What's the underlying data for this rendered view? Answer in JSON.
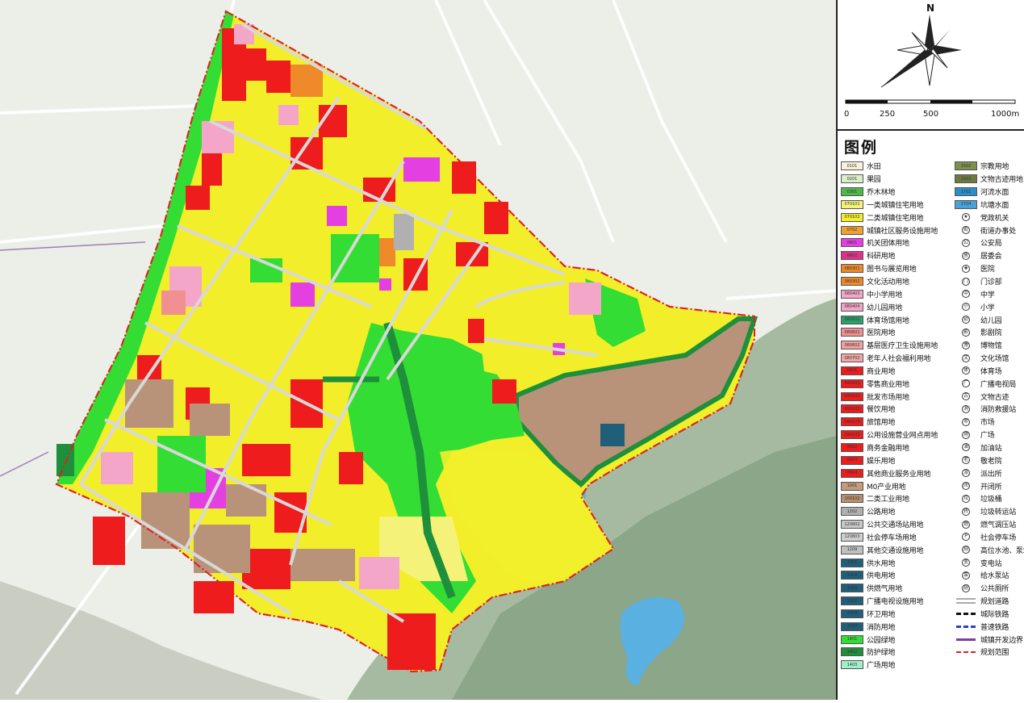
{
  "compass": {
    "north": "N"
  },
  "scale": {
    "ticks": [
      "0",
      "250",
      "500",
      "1000m"
    ]
  },
  "legend": {
    "title": "图例",
    "col1": [
      {
        "code": "0101",
        "label": "水田",
        "color": "#f6f0dc"
      },
      {
        "code": "0201",
        "label": "果园",
        "color": "#d9efc6"
      },
      {
        "code": "0301",
        "label": "乔木林地",
        "color": "#4fb84a"
      },
      {
        "code": "070101",
        "label": "一类城镇住宅用地",
        "color": "#f5f27a"
      },
      {
        "code": "070102",
        "label": "二类城镇住宅用地",
        "color": "#f2ef2a"
      },
      {
        "code": "0702",
        "label": "城镇社区服务设施用地",
        "color": "#f0a030"
      },
      {
        "code": "0801",
        "label": "机关团体用地",
        "color": "#e43fe0"
      },
      {
        "code": "0802",
        "label": "科研用地",
        "color": "#e0308a"
      },
      {
        "code": "080301",
        "label": "图书与展览用地",
        "color": "#ee8a2a"
      },
      {
        "code": "080302",
        "label": "文化活动用地",
        "color": "#ee8a2a"
      },
      {
        "code": "080403",
        "label": "中小学用地",
        "color": "#f4a6c8"
      },
      {
        "code": "080404",
        "label": "幼儿园用地",
        "color": "#f4a6c8"
      },
      {
        "code": "080502",
        "label": "体育场馆用地",
        "color": "#2aa06a"
      },
      {
        "code": "080601",
        "label": "医院用地",
        "color": "#f09090"
      },
      {
        "code": "080602",
        "label": "基层医疗卫生设施用地",
        "color": "#f4a0a0"
      },
      {
        "code": "080702",
        "label": "老年人社会福利用地",
        "color": "#f4a6a6"
      },
      {
        "code": "0901",
        "label": "商业用地",
        "color": "#ee1c1c"
      },
      {
        "code": "090101",
        "label": "零售商业用地",
        "color": "#ee1c1c"
      },
      {
        "code": "090102",
        "label": "批发市场用地",
        "color": "#ee1c1c"
      },
      {
        "code": "090103",
        "label": "餐饮用地",
        "color": "#ee1c1c"
      },
      {
        "code": "090104",
        "label": "旅馆用地",
        "color": "#ee1c1c"
      },
      {
        "code": "090105",
        "label": "公用设施营业网点用地",
        "color": "#ee1c1c"
      },
      {
        "code": "0902",
        "label": "商务金融用地",
        "color": "#ee1c1c"
      },
      {
        "code": "0903",
        "label": "娱乐用地",
        "color": "#ee1c1c"
      },
      {
        "code": "0904",
        "label": "其他商业服务业用地",
        "color": "#ee1c1c"
      },
      {
        "code": "1001",
        "label": "M0产业用地",
        "color": "#c49a7a"
      },
      {
        "code": "100102",
        "label": "二类工业用地",
        "color": "#b98e6e"
      },
      {
        "code": "1202",
        "label": "公路用地",
        "color": "#b0b0b0"
      },
      {
        "code": "120802",
        "label": "公共交通场站用地",
        "color": "#c8c8c8"
      },
      {
        "code": "120803",
        "label": "社会停车场用地",
        "color": "#d0d0d0"
      },
      {
        "code": "1209",
        "label": "其他交通设施用地",
        "color": "#c0c0c0"
      },
      {
        "code": "1301",
        "label": "供水用地",
        "color": "#1f5f7a"
      },
      {
        "code": "1303",
        "label": "供电用地",
        "color": "#1f5f7a"
      },
      {
        "code": "1304",
        "label": "供燃气用地",
        "color": "#1f5f7a"
      },
      {
        "code": "1307",
        "label": "广播电视设施用地",
        "color": "#1f5f7a"
      },
      {
        "code": "1309",
        "label": "环卫用地",
        "color": "#1f5f7a"
      },
      {
        "code": "1310",
        "label": "消防用地",
        "color": "#1f5f7a"
      },
      {
        "code": "1401",
        "label": "公园绿地",
        "color": "#33dd33"
      },
      {
        "code": "1402",
        "label": "防护绿地",
        "color": "#1e8f3a"
      },
      {
        "code": "1403",
        "label": "广场用地",
        "color": "#9ff0c8"
      }
    ],
    "col2": [
      {
        "code": "1502",
        "label": "宗教用地",
        "color": "#7f8f4f",
        "kind": "swatch"
      },
      {
        "code": "1503",
        "label": "文物古迹用地",
        "color": "#6f7a3f",
        "kind": "swatch"
      },
      {
        "code": "1701",
        "label": "河流水面",
        "color": "#2a8fc8",
        "kind": "swatch"
      },
      {
        "code": "1704",
        "label": "坑塘水面",
        "color": "#4aa0d8",
        "kind": "swatch"
      },
      {
        "glyph": "★",
        "label": "党政机关",
        "kind": "symbol"
      },
      {
        "glyph": "街",
        "label": "街道办事处",
        "kind": "symbol"
      },
      {
        "glyph": "公",
        "label": "公安局",
        "kind": "symbol"
      },
      {
        "glyph": "居",
        "label": "居委会",
        "kind": "symbol"
      },
      {
        "glyph": "✚",
        "label": "医院",
        "kind": "symbol"
      },
      {
        "glyph": "门",
        "label": "门诊部",
        "kind": "symbol"
      },
      {
        "glyph": "中",
        "label": "中学",
        "kind": "symbol"
      },
      {
        "glyph": "小",
        "label": "小学",
        "kind": "symbol"
      },
      {
        "glyph": "幼",
        "label": "幼儿园",
        "kind": "symbol"
      },
      {
        "glyph": "影",
        "label": "影剧院",
        "kind": "symbol"
      },
      {
        "glyph": "博",
        "label": "博物馆",
        "kind": "symbol"
      },
      {
        "glyph": "文",
        "label": "文化场馆",
        "kind": "symbol"
      },
      {
        "glyph": "体",
        "label": "体育场",
        "kind": "symbol"
      },
      {
        "glyph": "广",
        "label": "广播电视局",
        "kind": "symbol"
      },
      {
        "glyph": "古",
        "label": "文物古迹",
        "kind": "symbol"
      },
      {
        "glyph": "消",
        "label": "消防救援站",
        "kind": "symbol"
      },
      {
        "glyph": "市",
        "label": "市场",
        "kind": "symbol"
      },
      {
        "glyph": "场",
        "label": "广场",
        "kind": "symbol"
      },
      {
        "glyph": "油",
        "label": "加油站",
        "kind": "symbol"
      },
      {
        "glyph": "老",
        "label": "敬老院",
        "kind": "symbol"
      },
      {
        "glyph": "派",
        "label": "派出所",
        "kind": "symbol"
      },
      {
        "glyph": "闭",
        "label": "开闭所",
        "kind": "symbol"
      },
      {
        "glyph": "垃",
        "label": "垃圾桶",
        "kind": "symbol"
      },
      {
        "glyph": "转",
        "label": "垃圾转运站",
        "kind": "symbol"
      },
      {
        "glyph": "燃",
        "label": "燃气调压站",
        "kind": "symbol"
      },
      {
        "glyph": "P",
        "label": "社会停车场",
        "kind": "symbol"
      },
      {
        "glyph": "厕",
        "label": "高位水池、泵站",
        "kind": "symbol"
      },
      {
        "glyph": "变",
        "label": "变电站",
        "kind": "symbol"
      },
      {
        "glyph": "泵",
        "label": "给水泵站",
        "kind": "symbol"
      },
      {
        "glyph": "厕",
        "label": "公共厕所",
        "kind": "symbol"
      },
      {
        "label": "规划道路",
        "kind": "line",
        "style": "road"
      },
      {
        "label": "城际铁路",
        "kind": "line",
        "style": "rail1"
      },
      {
        "label": "普速铁路",
        "kind": "line",
        "style": "rail2"
      },
      {
        "label": "城镇开发边界",
        "kind": "line",
        "style": "boundary"
      },
      {
        "label": "规划范围",
        "kind": "line",
        "style": "scope"
      }
    ]
  }
}
